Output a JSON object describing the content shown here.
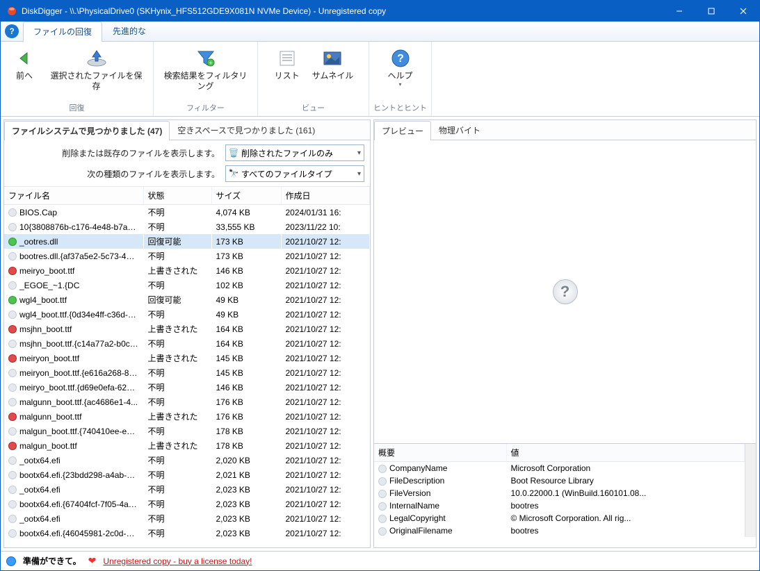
{
  "window": {
    "title": "DiskDigger - \\\\.\\PhysicalDrive0 (SKHynix_HFS512GDE9X081N NVMe Device) - Unregistered copy"
  },
  "tabs": {
    "file_recovery": "ファイルの回復",
    "advanced": "先進的な"
  },
  "ribbon": {
    "back": "前へ",
    "save_selected": "選択されたファイルを保存",
    "filter_results": "検索結果をフィルタリング",
    "list": "リスト",
    "thumbnail": "サムネイル",
    "help": "ヘルプ",
    "group_recovery": "回復",
    "group_filter": "フィルター",
    "group_view": "ビュー",
    "group_hints": "ヒントとヒント"
  },
  "left": {
    "tab_fs": "ファイルシステムで見つかりました (47)",
    "tab_free": "空きスペースで見つかりました (161)",
    "filter_deleted_label": "削除または既存のファイルを表示します。",
    "filter_deleted_value": "削除されたファイルのみ",
    "filter_type_label": "次の種類のファイルを表示します。",
    "filter_type_value": "すべてのファイルタイプ",
    "cols": {
      "name": "ファイル名",
      "status": "状態",
      "size": "サイズ",
      "created": "作成日"
    },
    "rows": [
      {
        "c": "grey",
        "name": "BIOS.Cap",
        "status": "不明",
        "size": "4,074 KB",
        "date": "2024/01/31 16:"
      },
      {
        "c": "grey",
        "name": "10{3808876b-c176-4e48-b7ae-0...",
        "status": "不明",
        "size": "33,555 KB",
        "date": "2023/11/22 10:"
      },
      {
        "c": "green",
        "name": "_ootres.dll",
        "status": "回復可能",
        "size": "173 KB",
        "date": "2021/10/27 12:",
        "sel": true
      },
      {
        "c": "grey",
        "name": "bootres.dll.{af37a5e2-5c73-4ab...",
        "status": "不明",
        "size": "173 KB",
        "date": "2021/10/27 12:"
      },
      {
        "c": "red",
        "name": "meiryo_boot.ttf",
        "status": "上書きされた",
        "size": "146 KB",
        "date": "2021/10/27 12:"
      },
      {
        "c": "grey",
        "name": "_EGOE_~1.{DC",
        "status": "不明",
        "size": "102 KB",
        "date": "2021/10/27 12:"
      },
      {
        "c": "green",
        "name": "wgl4_boot.ttf",
        "status": "回復可能",
        "size": "49 KB",
        "date": "2021/10/27 12:"
      },
      {
        "c": "grey",
        "name": "wgl4_boot.ttf.{0d34e4ff-c36d-4...",
        "status": "不明",
        "size": "49 KB",
        "date": "2021/10/27 12:"
      },
      {
        "c": "red",
        "name": "msjhn_boot.ttf",
        "status": "上書きされた",
        "size": "164 KB",
        "date": "2021/10/27 12:"
      },
      {
        "c": "grey",
        "name": "msjhn_boot.ttf.{c14a77a2-b0c9...",
        "status": "不明",
        "size": "164 KB",
        "date": "2021/10/27 12:"
      },
      {
        "c": "red",
        "name": "meiryon_boot.ttf",
        "status": "上書きされた",
        "size": "145 KB",
        "date": "2021/10/27 12:"
      },
      {
        "c": "grey",
        "name": "meiryon_boot.ttf.{e616a268-86...",
        "status": "不明",
        "size": "145 KB",
        "date": "2021/10/27 12:"
      },
      {
        "c": "grey",
        "name": "meiryo_boot.ttf.{d69e0efa-6219...",
        "status": "不明",
        "size": "146 KB",
        "date": "2021/10/27 12:"
      },
      {
        "c": "grey",
        "name": "malgunn_boot.ttf.{ac4686e1-4...",
        "status": "不明",
        "size": "176 KB",
        "date": "2021/10/27 12:"
      },
      {
        "c": "red",
        "name": "malgunn_boot.ttf",
        "status": "上書きされた",
        "size": "176 KB",
        "date": "2021/10/27 12:"
      },
      {
        "c": "grey",
        "name": "malgun_boot.ttf.{740410ee-e7e...",
        "status": "不明",
        "size": "178 KB",
        "date": "2021/10/27 12:"
      },
      {
        "c": "red",
        "name": "malgun_boot.ttf",
        "status": "上書きされた",
        "size": "178 KB",
        "date": "2021/10/27 12:"
      },
      {
        "c": "grey",
        "name": "_ootx64.efi",
        "status": "不明",
        "size": "2,020 KB",
        "date": "2021/10/27 12:"
      },
      {
        "c": "grey",
        "name": "bootx64.efi.{23bdd298-a4ab-43...",
        "status": "不明",
        "size": "2,021 KB",
        "date": "2021/10/27 12:"
      },
      {
        "c": "grey",
        "name": "_ootx64.efi",
        "status": "不明",
        "size": "2,023 KB",
        "date": "2021/10/27 12:"
      },
      {
        "c": "grey",
        "name": "bootx64.efi.{67404fcf-7f05-4ac...",
        "status": "不明",
        "size": "2,023 KB",
        "date": "2021/10/27 12:"
      },
      {
        "c": "grey",
        "name": "_ootx64.efi",
        "status": "不明",
        "size": "2,023 KB",
        "date": "2021/10/27 12:"
      },
      {
        "c": "grey",
        "name": "bootx64.efi.{46045981-2c0d-41...",
        "status": "不明",
        "size": "2,023 KB",
        "date": "2021/10/27 12:"
      }
    ]
  },
  "right": {
    "tab_preview": "プレビュー",
    "tab_bytes": "物理バイト",
    "props_cols": {
      "overview": "概要",
      "value": "値"
    },
    "props": [
      {
        "k": "CompanyName",
        "v": "Microsoft Corporation"
      },
      {
        "k": "FileDescription",
        "v": "Boot Resource Library"
      },
      {
        "k": "FileVersion",
        "v": "10.0.22000.1 (WinBuild.160101.08..."
      },
      {
        "k": "InternalName",
        "v": "bootres"
      },
      {
        "k": "LegalCopyright",
        "v": "© Microsoft Corporation. All rig..."
      },
      {
        "k": "OriginalFilename",
        "v": "bootres"
      }
    ]
  },
  "status": {
    "ready": "準備ができて。",
    "unreg": "Unregistered copy - buy a license today!"
  }
}
